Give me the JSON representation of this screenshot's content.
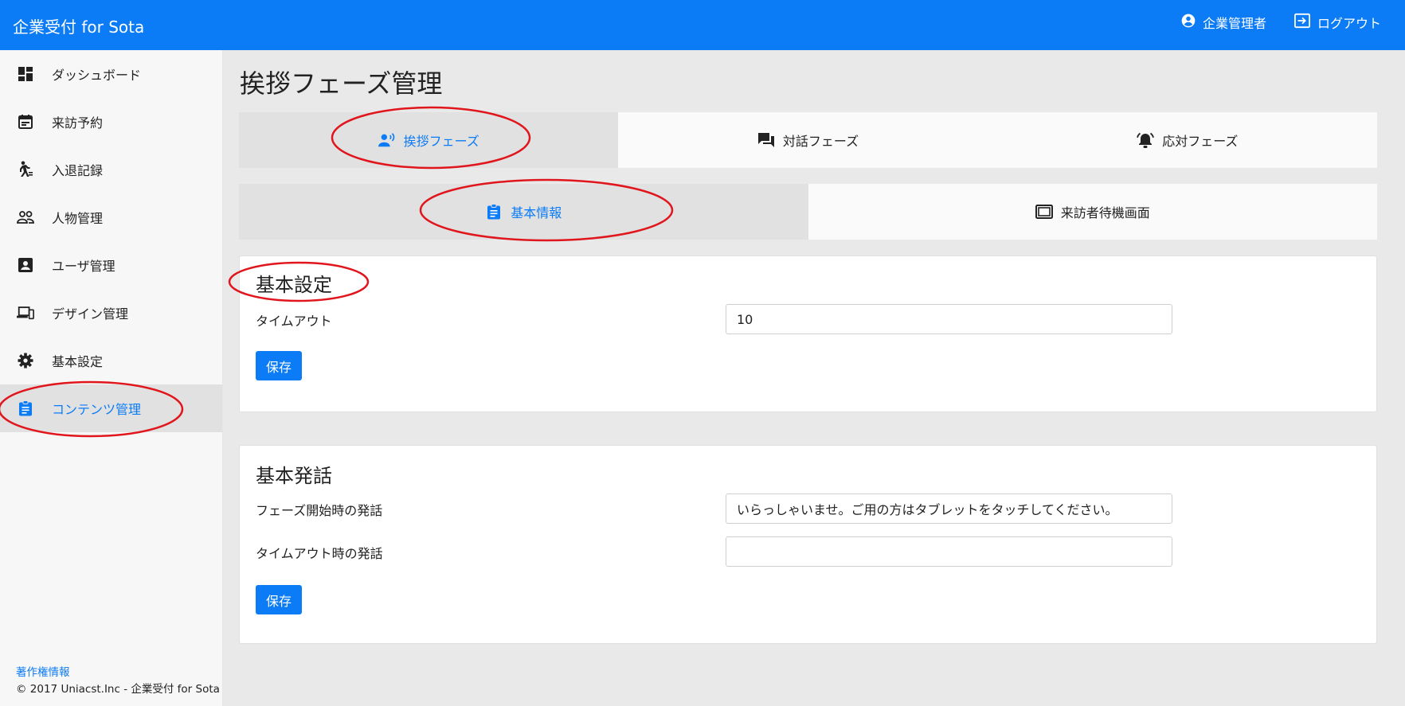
{
  "header": {
    "brand": "企業受付 for Sota",
    "user_label": "企業管理者",
    "logout_label": "ログアウト"
  },
  "sidebar": {
    "items": [
      {
        "label": "ダッシュボード",
        "icon": "dashboard-icon"
      },
      {
        "label": "来訪予約",
        "icon": "calendar-icon"
      },
      {
        "label": "入退記録",
        "icon": "walking-icon"
      },
      {
        "label": "人物管理",
        "icon": "people-icon"
      },
      {
        "label": "ユーザ管理",
        "icon": "account-box-icon"
      },
      {
        "label": "デザイン管理",
        "icon": "devices-icon"
      },
      {
        "label": "基本設定",
        "icon": "gear-icon"
      },
      {
        "label": "コンテンツ管理",
        "icon": "clipboard-icon",
        "active": true
      }
    ],
    "footer_link": "著作権情報",
    "footer_copy": "© 2017 Uniacst.Inc - 企業受付 for Sota"
  },
  "main": {
    "title": "挨拶フェーズ管理",
    "phase_tabs": [
      {
        "label": "挨拶フェーズ",
        "icon": "record-voice-icon",
        "active": true
      },
      {
        "label": "対話フェーズ",
        "icon": "chat-icon"
      },
      {
        "label": "応対フェーズ",
        "icon": "alarm-bell-icon"
      }
    ],
    "sub_tabs": [
      {
        "label": "基本情報",
        "icon": "clipboard-icon",
        "active": true
      },
      {
        "label": "来訪者待機画面",
        "icon": "tablet-icon"
      }
    ],
    "basic_settings": {
      "title": "基本設定",
      "timeout_label": "タイムアウト",
      "timeout_value": "10",
      "save_label": "保存"
    },
    "basic_speech": {
      "title": "基本発話",
      "start_label": "フェーズ開始時の発話",
      "start_value": "いらっしゃいませ。ご用の方はタブレットをタッチしてください。",
      "timeout_label": "タイムアウト時の発話",
      "timeout_value": "",
      "save_label": "保存"
    }
  },
  "colors": {
    "accent": "#0b7bf6",
    "annotation": "#e0161c"
  }
}
